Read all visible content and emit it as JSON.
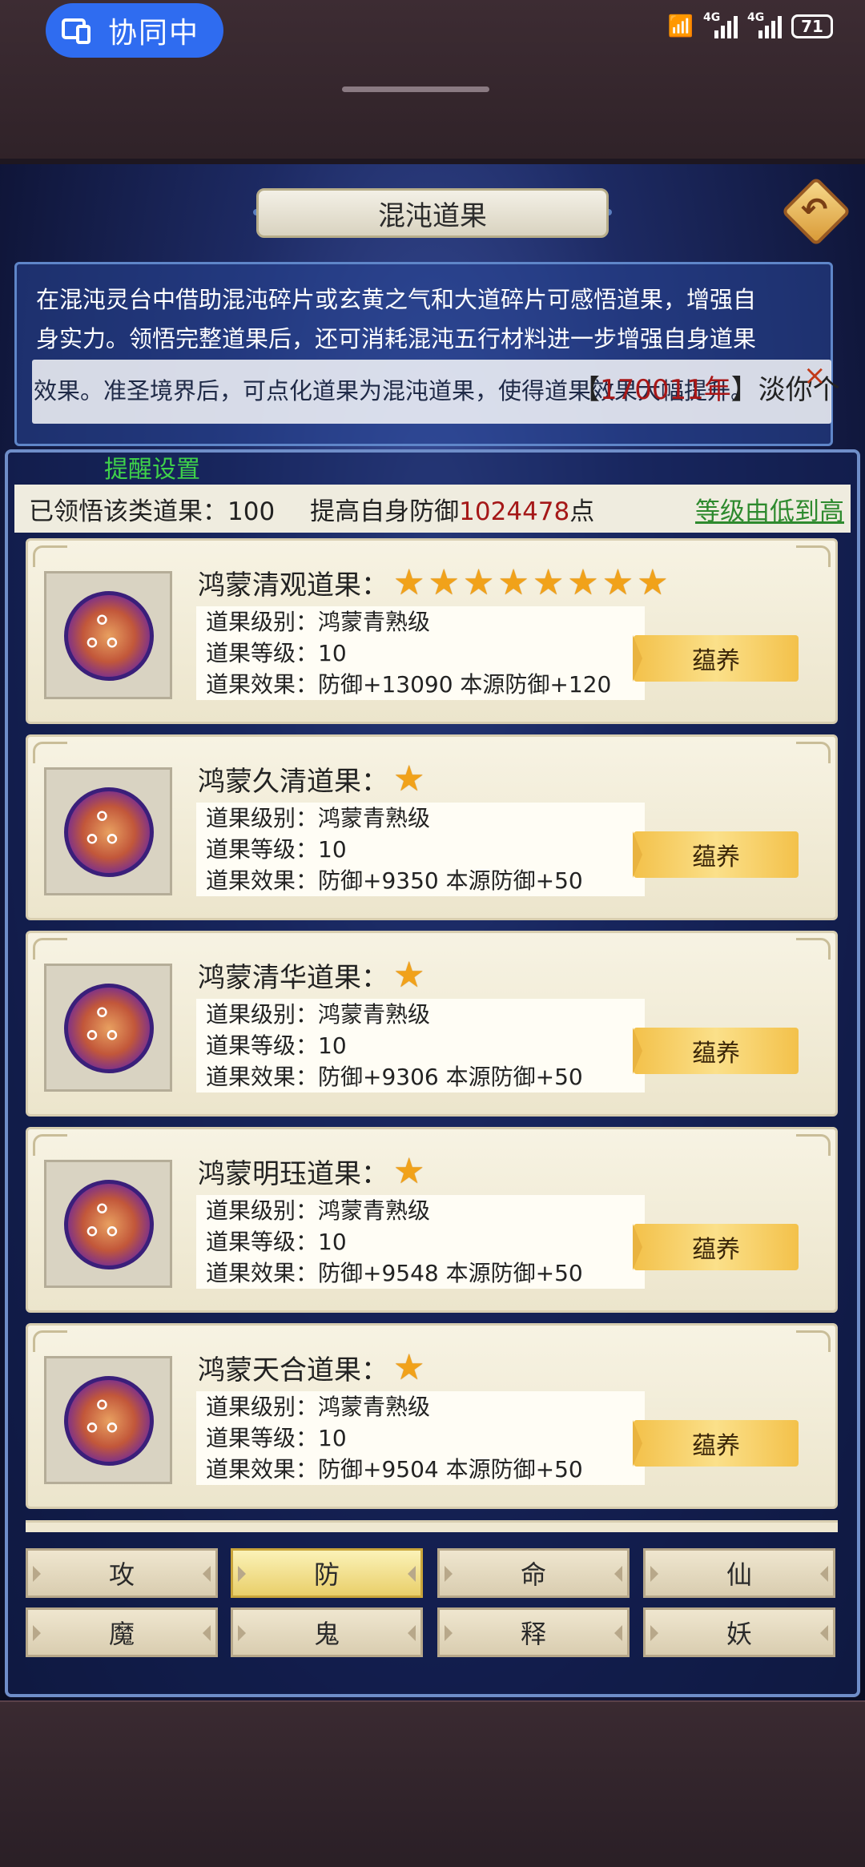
{
  "status": {
    "collab_label": "协同中",
    "signal1": "4G",
    "signal2": "4G",
    "battery": "71"
  },
  "page": {
    "title": "混沌道果",
    "description_lines": [
      "在混沌灵台中借助混沌碎片或玄黄之气和大道碎片可感悟道果，增强自",
      "身实力。领悟完整道果后，还可消耗混沌五行材料进一步增强自身道果",
      "效果。准圣境界后，可点化道果为混沌道果，使得道果效果大幅提升。"
    ],
    "banner_visible": "效果。准圣境界后，可点化道果为混沌道果，使得道果效果大幅提升。",
    "banner_name_prefix": "【",
    "banner_name_value": "170011年",
    "banner_name_suffix": "】淡你个",
    "close_label": "×",
    "remind_label": "提醒设置"
  },
  "summary": {
    "count_text": "已领悟该类道果：100",
    "defense_prefix": "提高自身防御",
    "defense_value": "1024478",
    "defense_suffix": "点",
    "sort_label": "等级由低到高"
  },
  "cards": [
    {
      "name": "鸿蒙清观道果：",
      "stars": 8,
      "grade": "道果级别：鸿蒙青熟级",
      "level": "道果等级：10",
      "effect": "道果效果：防御+13090  本源防御+120",
      "button": "蕴养"
    },
    {
      "name": "鸿蒙久清道果：",
      "stars": 1,
      "grade": "道果级别：鸿蒙青熟级",
      "level": "道果等级：10",
      "effect": "道果效果：防御+9350  本源防御+50",
      "button": "蕴养"
    },
    {
      "name": "鸿蒙清华道果：",
      "stars": 1,
      "grade": "道果级别：鸿蒙青熟级",
      "level": "道果等级：10",
      "effect": "道果效果：防御+9306  本源防御+50",
      "button": "蕴养"
    },
    {
      "name": "鸿蒙明珏道果：",
      "stars": 1,
      "grade": "道果级别：鸿蒙青熟级",
      "level": "道果等级：10",
      "effect": "道果效果：防御+9548  本源防御+50",
      "button": "蕴养"
    },
    {
      "name": "鸿蒙天合道果：",
      "stars": 1,
      "grade": "道果级别：鸿蒙青熟级",
      "level": "道果等级：10",
      "effect": "道果效果：防御+9504  本源防御+50",
      "button": "蕴养"
    }
  ],
  "tabs": [
    {
      "label": "攻",
      "active": false
    },
    {
      "label": "防",
      "active": true
    },
    {
      "label": "命",
      "active": false
    },
    {
      "label": "仙",
      "active": false
    },
    {
      "label": "魔",
      "active": false
    },
    {
      "label": "鬼",
      "active": false
    },
    {
      "label": "释",
      "active": false
    },
    {
      "label": "妖",
      "active": false
    }
  ],
  "icons": {
    "back": "back-arrow-icon",
    "fruit": "dragon-orb-icon",
    "star": "star-icon"
  },
  "colors": {
    "highlight_red": "#a51818",
    "sort_green": "#2e8a2e",
    "remind_green": "#3fd24a",
    "star_gold": "#f1a21a"
  }
}
